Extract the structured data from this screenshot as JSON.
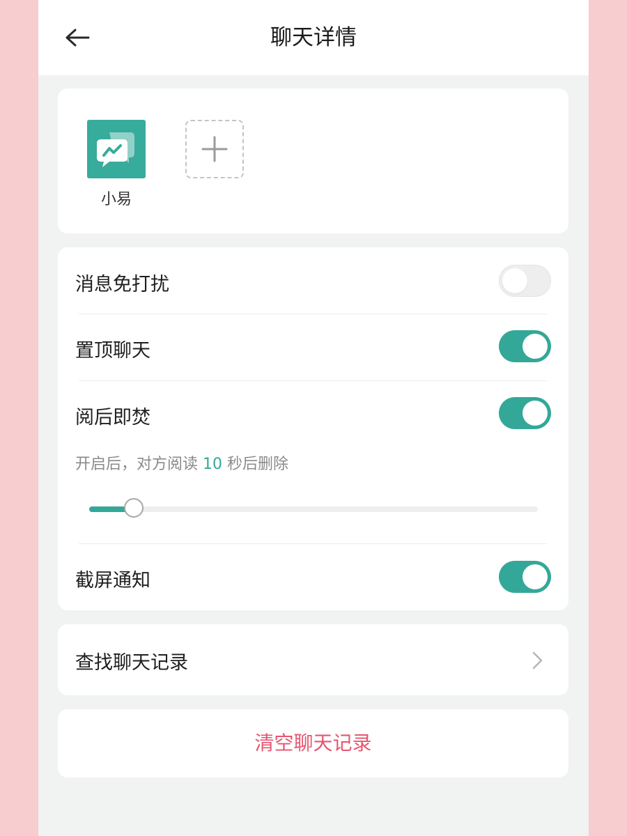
{
  "header": {
    "title": "聊天详情",
    "back_icon": "arrow-left-icon"
  },
  "members": {
    "items": [
      {
        "name": "小易",
        "avatar_icon": "chat-bubbles-icon",
        "avatar_color": "#37ab9c"
      }
    ],
    "add_icon": "plus-icon"
  },
  "settings": {
    "mute": {
      "label": "消息免打扰",
      "enabled": false
    },
    "pin": {
      "label": "置顶聊天",
      "enabled": true
    },
    "burn": {
      "label": "阅后即焚",
      "enabled": true,
      "hint_prefix": "开启后，对方阅读 ",
      "hint_value": "10",
      "hint_suffix": " 秒后删除",
      "slider_fraction": 0.1
    },
    "screenshot": {
      "label": "截屏通知",
      "enabled": true
    }
  },
  "search": {
    "label": "查找聊天记录",
    "chevron_icon": "chevron-right-icon"
  },
  "clear": {
    "label": "清空聊天记录"
  },
  "colors": {
    "accent": "#33a898",
    "danger": "#e5566f",
    "page_bg": "#f1f2f2",
    "outer_bg": "#f7cdd0"
  }
}
